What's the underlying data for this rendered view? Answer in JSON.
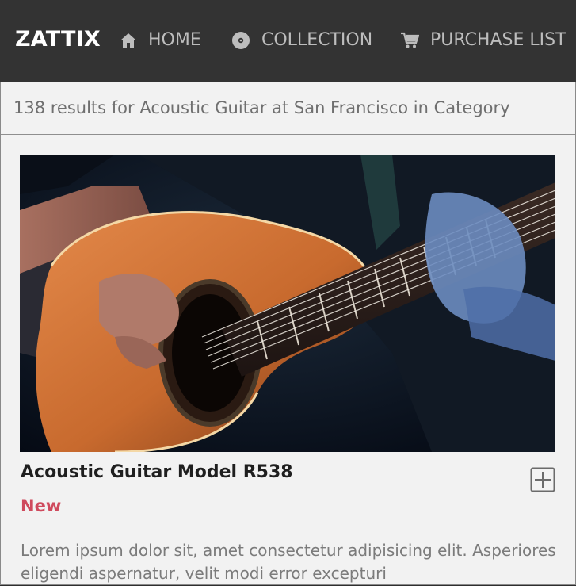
{
  "brand": "ZATTIX",
  "nav": {
    "home": {
      "label": "HOME",
      "icon": "home-icon"
    },
    "collection": {
      "label": "COLLECTION",
      "icon": "disc-icon"
    },
    "purchase": {
      "label": "PURCHASE LIST",
      "icon": "cart-icon"
    }
  },
  "results_text": "138 results for Acoustic Guitar at San Francisco in Category",
  "product": {
    "title": "Acoustic Guitar Model R538",
    "badge": "New",
    "description": "Lorem ipsum dolor sit, amet consectetur adipisicing elit. Asperiores eligendi aspernatur, velit modi error excepturi"
  },
  "colors": {
    "navbar": "#333333",
    "brand_text": "#ffffff",
    "nav_text": "#bdbdbd",
    "badge": "#cf4a5d",
    "panel_bg": "#f2f2f2"
  }
}
